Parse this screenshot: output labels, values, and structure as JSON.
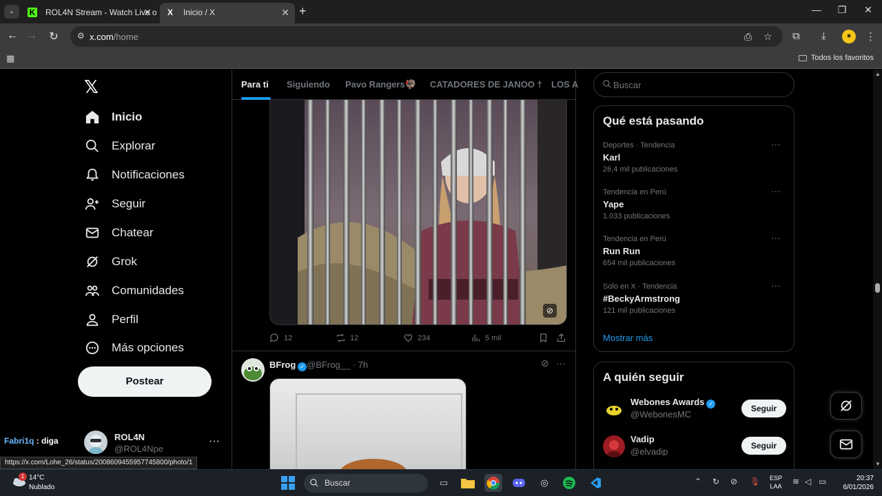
{
  "browser": {
    "tabs": [
      {
        "title": "ROL4N Stream - Watch Live on",
        "favicon": "K",
        "active": false
      },
      {
        "title": "Inicio / X",
        "favicon": "X",
        "active": true
      }
    ],
    "url_host": "x.com",
    "url_path": "/home",
    "bookmarks_label": "Todos los favoritos",
    "profile_initial": "✶",
    "status_url": "https://x.com/Lohe_26/status/2008609455957745800/photo/1"
  },
  "sidebar": {
    "logo": "𝕏",
    "items": [
      {
        "label": "Inicio",
        "icon": "home-icon",
        "active": true
      },
      {
        "label": "Explorar",
        "icon": "search-icon",
        "active": false
      },
      {
        "label": "Notificaciones",
        "icon": "bell-icon",
        "active": false
      },
      {
        "label": "Seguir",
        "icon": "add-person-icon",
        "active": false
      },
      {
        "label": "Chatear",
        "icon": "mail-icon",
        "active": false
      },
      {
        "label": "Grok",
        "icon": "grok-icon",
        "active": false
      },
      {
        "label": "Comunidades",
        "icon": "communities-icon",
        "active": false
      },
      {
        "label": "Perfil",
        "icon": "person-icon",
        "active": false
      },
      {
        "label": "Más opciones",
        "icon": "more-circle-icon",
        "active": false
      }
    ],
    "post_button": "Postear",
    "account": {
      "name": "ROL4N",
      "handle": "@ROL4Npe",
      "more": "···"
    },
    "chat_overlay": {
      "user": "Fabri1q",
      "text": " : diga"
    }
  },
  "timeline": {
    "tabs": [
      "Para ti",
      "Siguiendo",
      "Pavo Rangers🦃",
      "CATADORES DE JANOO †",
      "LOS A"
    ],
    "selected_tab": 0,
    "post1": {
      "replies": "12",
      "reposts": "12",
      "likes": "234",
      "views": "5 mil"
    },
    "post2": {
      "name": "BFrog",
      "handle": "@BFrog__",
      "time": "· 7h"
    }
  },
  "right": {
    "search_placeholder": "Buscar",
    "trending": {
      "title": "Qué está pasando",
      "items": [
        {
          "context": "Deportes · Tendencia",
          "name": "Karl",
          "count": "26,4 mil publicaciones"
        },
        {
          "context": "Tendencia en Perú",
          "name": "Yape",
          "count": "1.033 publicaciones"
        },
        {
          "context": "Tendencia en Perú",
          "name": "Run Run",
          "count": "654 mil publicaciones"
        },
        {
          "context": "Solo en X · Tendencia",
          "name": "#BeckyArmstrong",
          "count": "121 mil publicaciones"
        }
      ],
      "show_more": "Mostrar más"
    },
    "who_to_follow": {
      "title": "A quién seguir",
      "items": [
        {
          "name": "Webones Awards",
          "handle": "@WebonesMC",
          "verified": true,
          "button": "Seguir"
        },
        {
          "name": "Vadip",
          "handle": "@elvadip",
          "verified": false,
          "button": "Seguir"
        }
      ]
    }
  },
  "taskbar": {
    "weather_temp": "14°C",
    "weather_desc": "Nublado",
    "weather_badge": "1",
    "search_label": "Buscar",
    "lang_top": "ESP",
    "lang_bottom": "LAA",
    "time": "20:37",
    "date": "6/01/2026"
  },
  "colors": {
    "accent": "#1d9bf0",
    "background": "#000000",
    "text": "#e7e9ea",
    "muted": "#71767b"
  }
}
